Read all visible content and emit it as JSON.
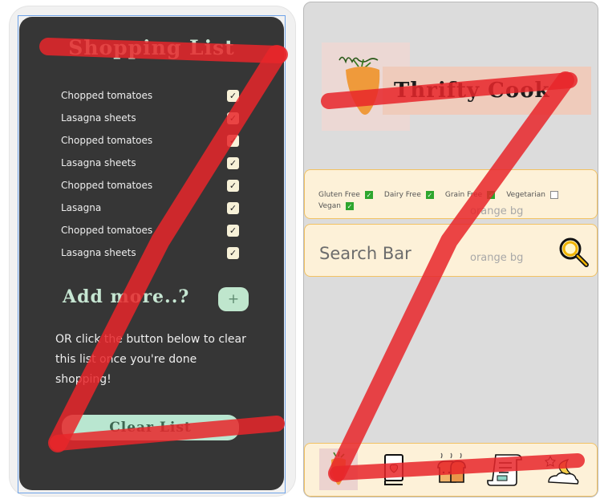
{
  "shopping": {
    "title": "Shopping List",
    "items": [
      {
        "label": "Chopped tomatoes",
        "check": "✓"
      },
      {
        "label": "Lasagna sheets",
        "check": "✓"
      },
      {
        "label": "Chopped tomatoes",
        "check": "✓"
      },
      {
        "label": "Lasagna sheets",
        "check": "✓"
      },
      {
        "label": "Chopped tomatoes",
        "check": "✓"
      },
      {
        "label": "Lasagna",
        "check": "✓"
      },
      {
        "label": "Chopped tomatoes",
        "check": "✓"
      },
      {
        "label": "Lasagna sheets",
        "check": "✓"
      }
    ],
    "add_more": "Add more..?",
    "add_button": "+",
    "clear_text": "OR click the button below to clear this list once you're done shopping!",
    "clear_button": "Clear List"
  },
  "thrifty": {
    "app_title": "Thrifty Cook",
    "filters": [
      {
        "label": "Gluten Free",
        "checked": true,
        "mark": "✓"
      },
      {
        "label": "Dairy Free",
        "checked": true,
        "mark": "✓"
      },
      {
        "label": "Grain Free",
        "checked": true,
        "mark": "✓"
      },
      {
        "label": "Vegetarian",
        "checked": false,
        "mark": ""
      },
      {
        "label": "Vegan",
        "checked": true,
        "mark": "✓"
      }
    ],
    "filter_note": "orange bg",
    "search_label": "Search Bar",
    "search_note": "orange bg",
    "nav": [
      {
        "icon": "carrot-icon",
        "active": true
      },
      {
        "icon": "recipe-book-icon",
        "active": false
      },
      {
        "icon": "bread-icon",
        "active": false
      },
      {
        "icon": "scroll-list-icon",
        "active": false
      },
      {
        "icon": "moon-stars-icon",
        "active": false
      }
    ]
  },
  "colors": {
    "dark_bg": "#363636",
    "mint": "#c6e6d2",
    "cream": "#fdf1d8",
    "orange_border": "#f2c263",
    "annotation_red": "#e8262a"
  }
}
